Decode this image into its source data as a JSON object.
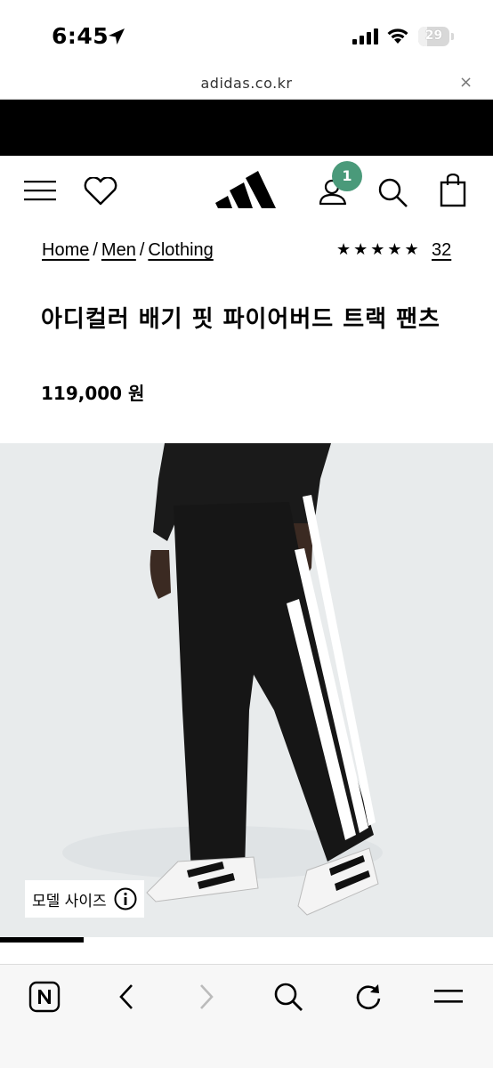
{
  "status_bar": {
    "time": "6:45",
    "battery": "29",
    "battery_level": 0.29,
    "icons": [
      "location-arrow-icon",
      "signal-icon",
      "wifi-icon",
      "battery-icon"
    ]
  },
  "url_bar": {
    "domain": "adidas.co.kr",
    "close_label": "×"
  },
  "header": {
    "icons": [
      "menu-icon",
      "wishlist-heart-icon",
      "adidas-logo",
      "account-icon",
      "search-icon",
      "bag-icon"
    ],
    "account_badge": "1",
    "badge_color": "#4a9a7a"
  },
  "breadcrumb": {
    "items": [
      "Home",
      "Men",
      "Clothing"
    ],
    "separator": "/"
  },
  "rating": {
    "stars": "★★★★★",
    "value": 5,
    "count": "32"
  },
  "product": {
    "title": "아디컬러 배기 핏 파이어버드 트랙 팬츠",
    "price": "119,000 원",
    "model_size_label": "모델 사이즈"
  },
  "gallery": {
    "progress": 0.17
  },
  "browser_toolbar": {
    "icons": [
      "naver-n-icon",
      "back-arrow-icon",
      "forward-arrow-icon",
      "search-icon",
      "reload-icon",
      "menu-icon"
    ]
  }
}
